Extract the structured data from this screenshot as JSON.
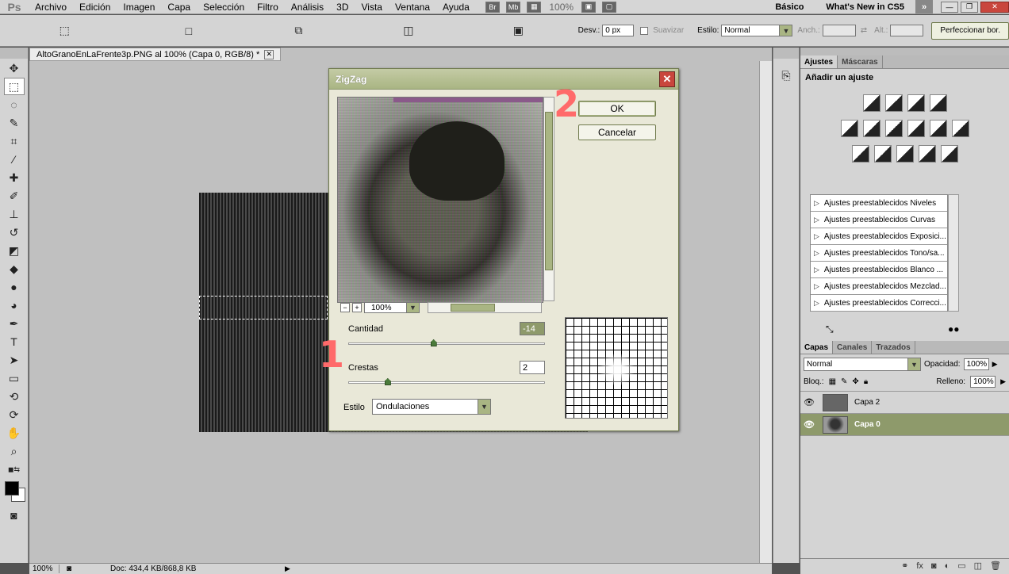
{
  "app": {
    "logo": "Ps"
  },
  "menu": {
    "items": [
      "Archivo",
      "Edición",
      "Imagen",
      "Capa",
      "Selección",
      "Filtro",
      "Análisis",
      "3D",
      "Vista",
      "Ventana",
      "Ayuda"
    ],
    "bridge": "Br",
    "minibridge": "Mb",
    "zoom": "100%",
    "workspace_basic": "Básico",
    "workspace_new": "What's New in CS5"
  },
  "options": {
    "feather_label": "Desv.:",
    "feather_value": "0 px",
    "antialias_label": "Suavizar",
    "style_label": "Estilo:",
    "style_value": "Normal",
    "width_label": "Anch.:",
    "height_label": "Alt.:",
    "refine_button": "Perfeccionar bor."
  },
  "document": {
    "tab_title": "AltoGranoEnLaFrente3p.PNG al 100% (Capa 0, RGB/8) *",
    "zoom": "100%",
    "doc_info": "Doc: 434,4 KB/868,8 KB"
  },
  "dialog": {
    "title": "ZigZag",
    "ok_label": "OK",
    "cancel_label": "Cancelar",
    "preview_zoom": "100%",
    "amount_label": "Cantidad",
    "amount_value": -14,
    "amount_display": "-14",
    "ridges_label": "Crestas",
    "ridges_value": 2,
    "ridges_display": "2",
    "style_label": "Estilo",
    "style_value": "Ondulaciones"
  },
  "annotations": {
    "one": "1",
    "two": "2"
  },
  "adjustments": {
    "tab_active": "Ajustes",
    "tab_other": "Máscaras",
    "title": "Añadir un ajuste",
    "presets": [
      "Ajustes preestablecidos Niveles",
      "Ajustes preestablecidos Curvas",
      "Ajustes preestablecidos Exposici...",
      "Ajustes preestablecidos Tono/sa...",
      "Ajustes preestablecidos Blanco ...",
      "Ajustes preestablecidos Mezclad...",
      "Ajustes preestablecidos Correcci..."
    ]
  },
  "layers": {
    "tabs": [
      "Capas",
      "Canales",
      "Trazados"
    ],
    "blend_mode": "Normal",
    "opacity_label": "Opacidad:",
    "opacity_value": "100%",
    "lock_label": "Bloq.:",
    "fill_label": "Relleno:",
    "fill_value": "100%",
    "items": [
      "Capa 2",
      "Capa 0"
    ],
    "selected": "Capa 0"
  },
  "colors": {
    "accent": "#8e9a6b",
    "annotation": "#ff6a6a",
    "dialog_title": "#a9b583"
  }
}
